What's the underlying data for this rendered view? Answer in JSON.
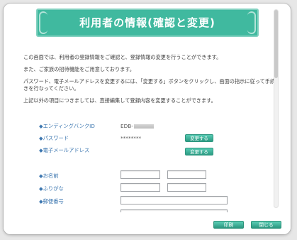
{
  "header": {
    "title": "利用者の情報(確認と変更)"
  },
  "intro": {
    "p1": "この画面では、利用者の登録情報をご確認と、登録情報の変更を行うことができます。",
    "p2": "また、ご家族の招待機能をご用意しております。",
    "p3": "パスワード、電子メールアドレスを変更するには、「変更する」ボタンをクリックし、画面の指示に従って手続きを行なってください。",
    "p4": "上記以外の項目につきましては、直接編集して登録内容を変更することができます。"
  },
  "fields": {
    "ending_bank_id": {
      "label": "◆エンディングバンクID",
      "value_prefix": "EDB-"
    },
    "password": {
      "label": "◆パスワード",
      "value": "********",
      "button": "変更する"
    },
    "email": {
      "label": "◆電子メールアドレス",
      "button": "変更する"
    },
    "name": {
      "label": "◆お名前"
    },
    "furigana": {
      "label": "◆ふりがな"
    },
    "postal_code": {
      "label": "◆郵便番号"
    }
  },
  "footer": {
    "print": "印刷",
    "close": "閉じる"
  },
  "colors": {
    "banner": "#40b99f",
    "label": "#3d77b0",
    "button": "#2d9b83"
  }
}
